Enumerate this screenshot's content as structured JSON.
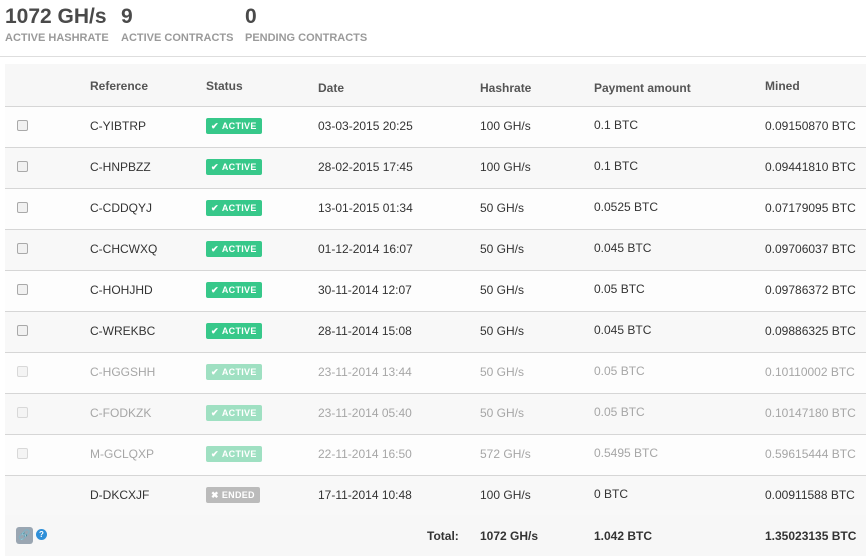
{
  "stats": {
    "hashrate": {
      "value": "1072 GH/s",
      "label": "ACTIVE HASHRATE"
    },
    "contracts": {
      "value": "9",
      "label": "ACTIVE CONTRACTS"
    },
    "pending": {
      "value": "0",
      "label": "PENDING CONTRACTS"
    }
  },
  "table": {
    "headers": {
      "reference": "Reference",
      "status": "Status",
      "date": "Date",
      "hashrate": "Hashrate",
      "payment": "Payment amount",
      "mined": "Mined"
    },
    "rows": [
      {
        "ref": "C-YIBTRP",
        "status": "ACTIVE",
        "date": "03-03-2015 20:25",
        "hashrate": "100 GH/s",
        "payment": "0.1 BTC",
        "mined": "0.09150870 BTC"
      },
      {
        "ref": "C-HNPBZZ",
        "status": "ACTIVE",
        "date": "28-02-2015 17:45",
        "hashrate": "100 GH/s",
        "payment": "0.1 BTC",
        "mined": "0.09441810 BTC"
      },
      {
        "ref": "C-CDDQYJ",
        "status": "ACTIVE",
        "date": "13-01-2015 01:34",
        "hashrate": "50 GH/s",
        "payment": "0.0525 BTC",
        "mined": "0.07179095 BTC"
      },
      {
        "ref": "C-CHCWXQ",
        "status": "ACTIVE",
        "date": "01-12-2014 16:07",
        "hashrate": "50 GH/s",
        "payment": "0.045 BTC",
        "mined": "0.09706037 BTC"
      },
      {
        "ref": "C-HOHJHD",
        "status": "ACTIVE",
        "date": "30-11-2014 12:07",
        "hashrate": "50 GH/s",
        "payment": "0.05 BTC",
        "mined": "0.09786372 BTC"
      },
      {
        "ref": "C-WREKBC",
        "status": "ACTIVE",
        "date": "28-11-2014 15:08",
        "hashrate": "50 GH/s",
        "payment": "0.045 BTC",
        "mined": "0.09886325 BTC"
      },
      {
        "ref": "C-HGGSHH",
        "status": "ACTIVE",
        "date": "23-11-2014 13:44",
        "hashrate": "50 GH/s",
        "payment": "0.05 BTC",
        "mined": "0.10110002 BTC"
      },
      {
        "ref": "C-FODKZK",
        "status": "ACTIVE",
        "date": "23-11-2014 05:40",
        "hashrate": "50 GH/s",
        "payment": "0.05 BTC",
        "mined": "0.10147180 BTC"
      },
      {
        "ref": "M-GCLQXP",
        "status": "ACTIVE",
        "date": "22-11-2014 16:50",
        "hashrate": "572 GH/s",
        "payment": "0.5495 BTC",
        "mined": "0.59615444 BTC"
      },
      {
        "ref": "D-DKCXJF",
        "status": "ENDED",
        "date": "17-11-2014 10:48",
        "hashrate": "100 GH/s",
        "payment": "0 BTC",
        "mined": "0.00911588 BTC"
      }
    ],
    "footer": {
      "label": "Total:",
      "hashrate": "1072 GH/s",
      "payment": "1.042 BTC",
      "mined": "1.35023135 BTC"
    }
  },
  "icons": {
    "check": "check-icon",
    "ended": "x-circle-icon",
    "link": "link-icon",
    "help": "help-icon"
  },
  "colors": {
    "active": "#37c88a",
    "ended": "#bbbbbb",
    "help": "#2f8fd8"
  }
}
